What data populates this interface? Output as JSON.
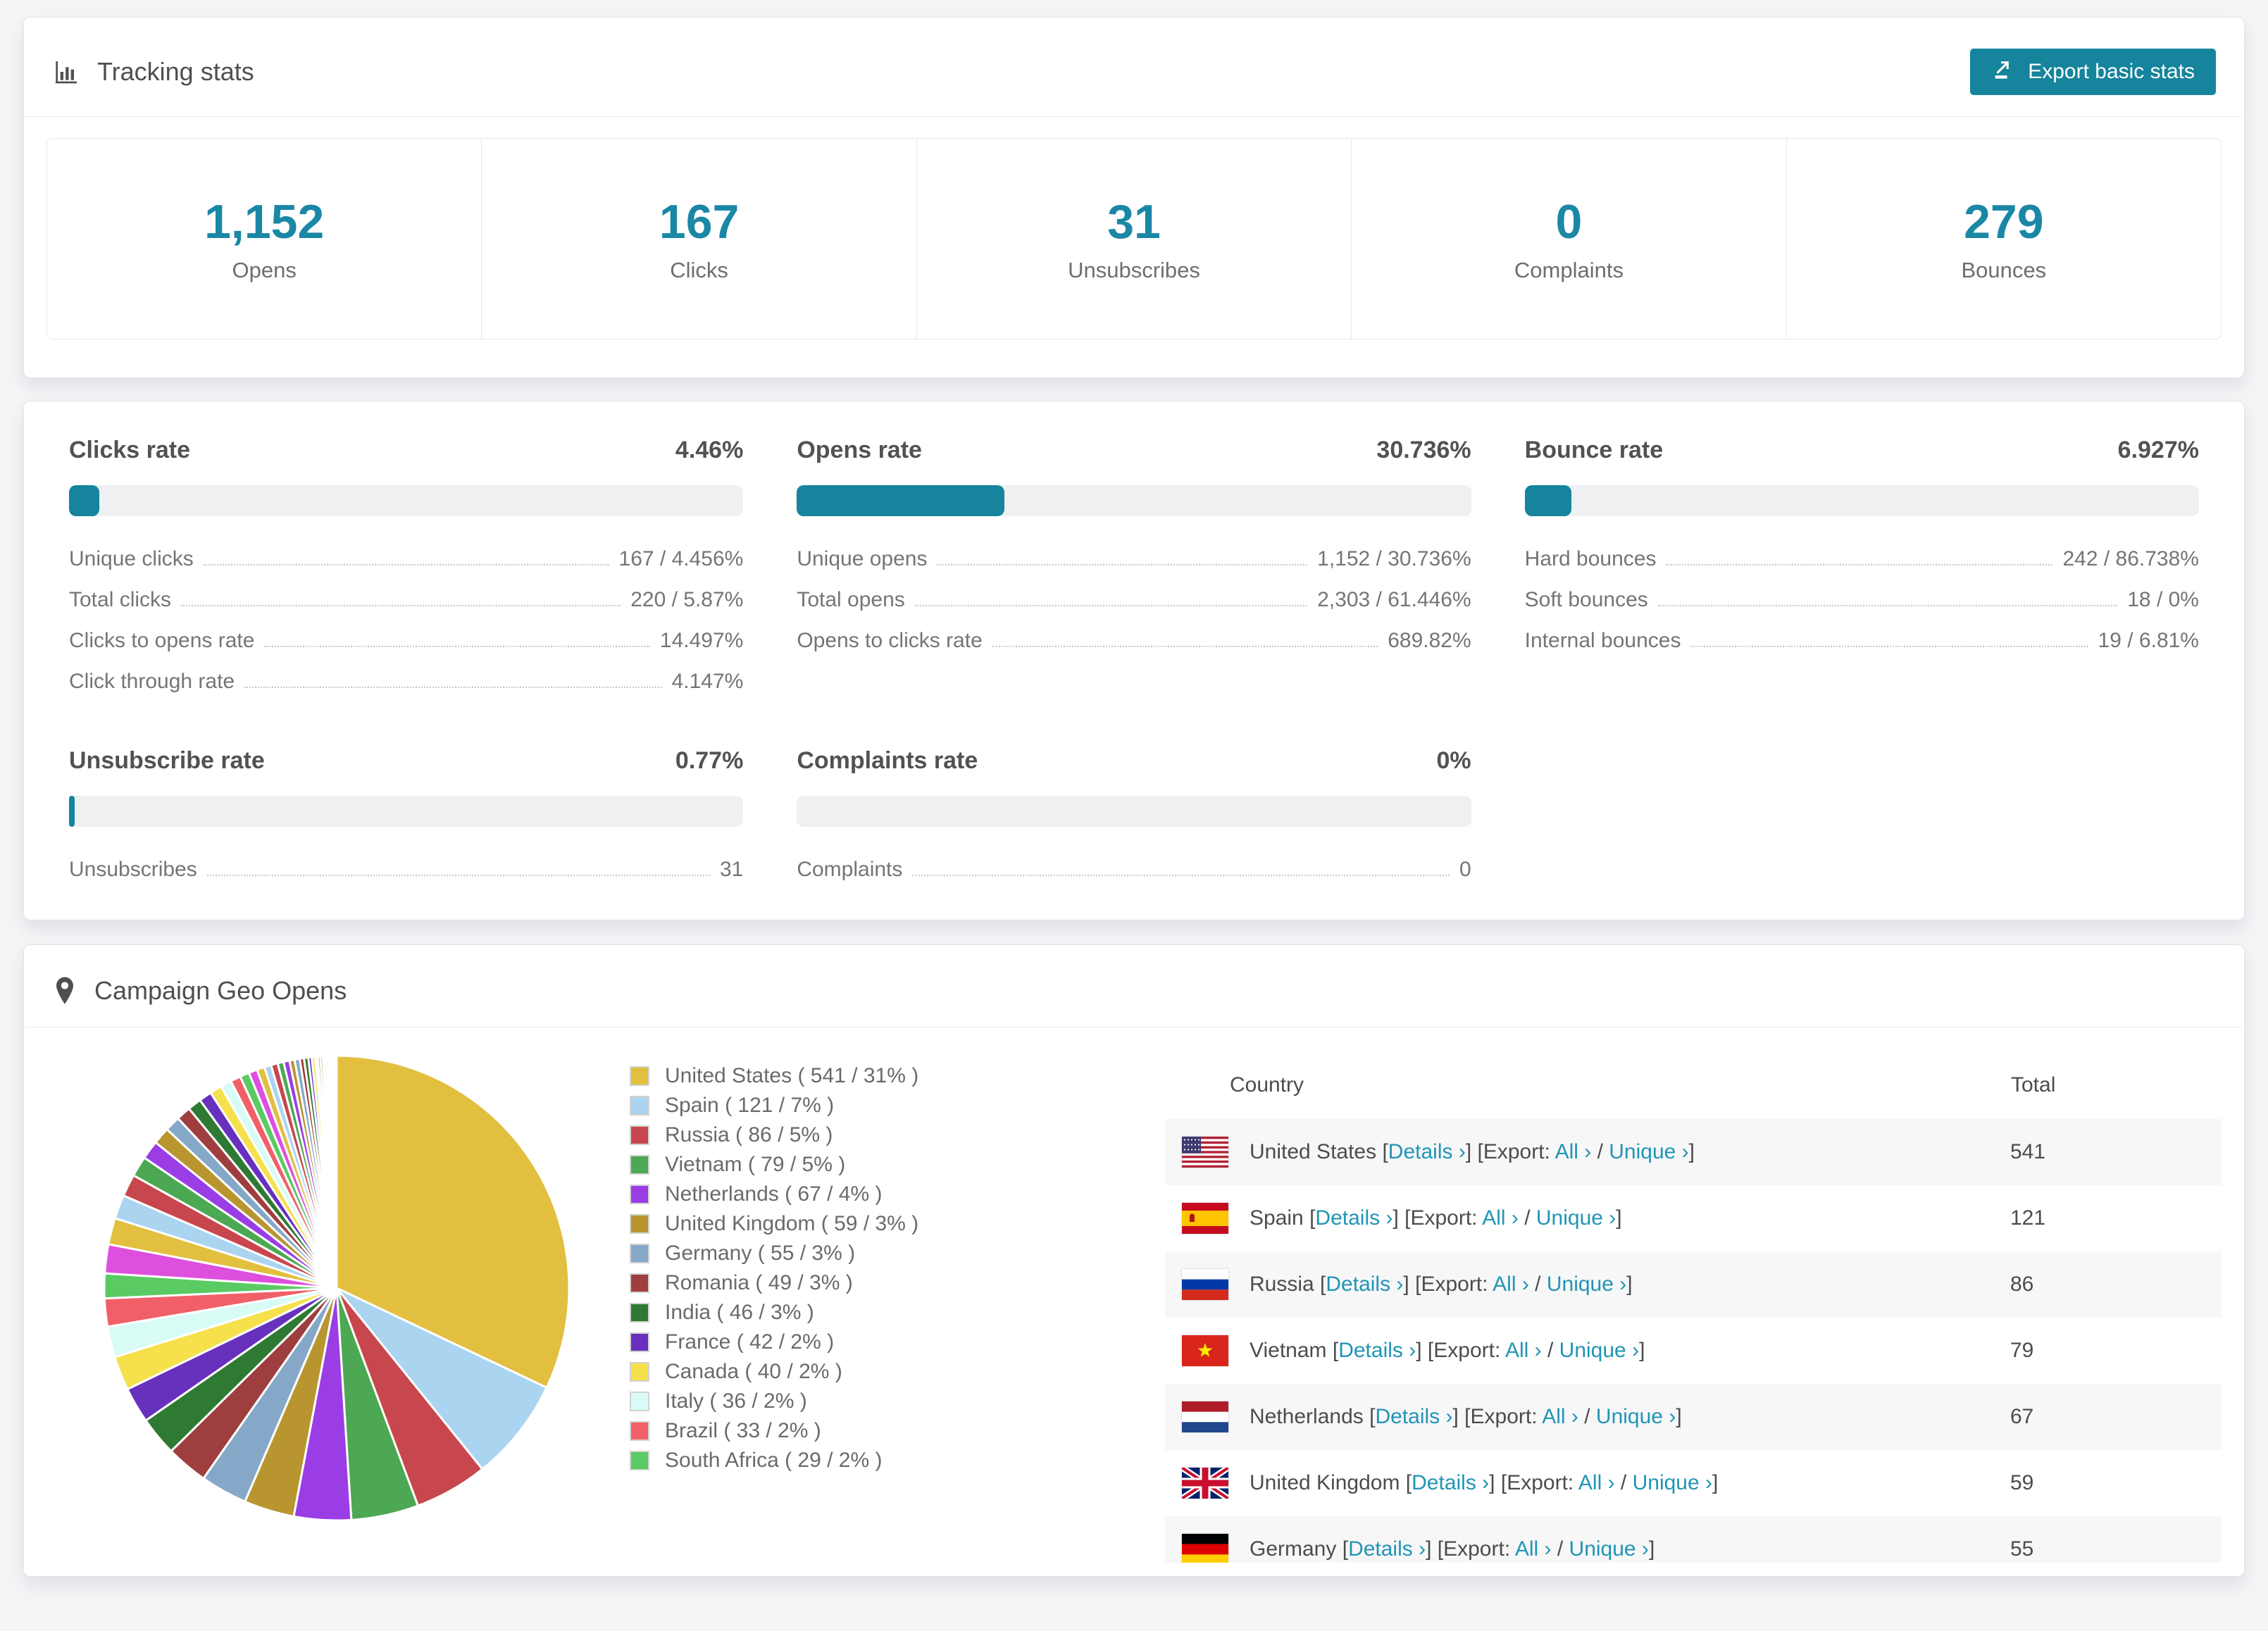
{
  "theme": {
    "accent": "#15849c",
    "stat_number_color": "#1a87a5",
    "link_color": "#2095b5",
    "bar_track_color": "#eef0f2"
  },
  "tracking": {
    "title": "Tracking stats",
    "export_button": "Export basic stats",
    "stats": [
      {
        "value": "1,152",
        "label": "Opens"
      },
      {
        "value": "167",
        "label": "Clicks"
      },
      {
        "value": "31",
        "label": "Unsubscribes"
      },
      {
        "value": "0",
        "label": "Complaints"
      },
      {
        "value": "279",
        "label": "Bounces"
      }
    ]
  },
  "rates": [
    {
      "title": "Clicks rate",
      "value": "4.46%",
      "percent": 4.46,
      "rows": [
        {
          "label": "Unique clicks",
          "value": "167 / 4.456%"
        },
        {
          "label": "Total clicks",
          "value": "220 / 5.87%"
        },
        {
          "label": "Clicks to opens rate",
          "value": "14.497%"
        },
        {
          "label": "Click through rate",
          "value": "4.147%"
        }
      ]
    },
    {
      "title": "Opens rate",
      "value": "30.736%",
      "percent": 30.736,
      "rows": [
        {
          "label": "Unique opens",
          "value": "1,152 / 30.736%"
        },
        {
          "label": "Total opens",
          "value": "2,303 / 61.446%"
        },
        {
          "label": "Opens to clicks rate",
          "value": "689.82%"
        }
      ]
    },
    {
      "title": "Bounce rate",
      "value": "6.927%",
      "percent": 6.927,
      "rows": [
        {
          "label": "Hard bounces",
          "value": "242 / 86.738%"
        },
        {
          "label": "Soft bounces",
          "value": "18 / 0%"
        },
        {
          "label": "Internal bounces",
          "value": "19 / 6.81%"
        }
      ]
    },
    {
      "title": "Unsubscribe rate",
      "value": "0.77%",
      "percent": 0.77,
      "rows": [
        {
          "label": "Unsubscribes",
          "value": "31"
        }
      ]
    },
    {
      "title": "Complaints rate",
      "value": "0%",
      "percent": 0,
      "rows": [
        {
          "label": "Complaints",
          "value": "0"
        }
      ]
    }
  ],
  "geo": {
    "title": "Campaign Geo Opens",
    "table": {
      "columns": [
        "Country",
        "Total"
      ],
      "links": {
        "bracket_open": "[",
        "bracket_close": "]",
        "details": "Details ›",
        "export_prefix": "Export:",
        "all": "All ›",
        "slash": " / ",
        "unique": "Unique ›"
      },
      "rows": [
        {
          "country": "United States",
          "flag": "us",
          "total": "541"
        },
        {
          "country": "Spain",
          "flag": "es",
          "total": "121"
        },
        {
          "country": "Russia",
          "flag": "ru",
          "total": "86"
        },
        {
          "country": "Vietnam",
          "flag": "vn",
          "total": "79"
        },
        {
          "country": "Netherlands",
          "flag": "nl",
          "total": "67"
        },
        {
          "country": "United Kingdom",
          "flag": "gb",
          "total": "59"
        },
        {
          "country": "Germany",
          "flag": "de",
          "total": "55",
          "partial": true
        }
      ]
    }
  },
  "chart_data": {
    "type": "pie",
    "title": "Campaign Geo Opens",
    "legend_position": "right",
    "start_angle_deg": -90,
    "direction": "clockwise",
    "countries": [
      {
        "label": "United States",
        "value": 541,
        "pct": "31%",
        "color": "#e2bf3f",
        "legend_label": "United States ( 541 / 31% )"
      },
      {
        "label": "Spain",
        "value": 121,
        "pct": "7%",
        "color": "#abd4f1",
        "legend_label": "Spain ( 121 / 7% )"
      },
      {
        "label": "Russia",
        "value": 86,
        "pct": "5%",
        "color": "#c8474e",
        "legend_label": "Russia ( 86 / 5% )"
      },
      {
        "label": "Vietnam",
        "value": 79,
        "pct": "5%",
        "color": "#4ca852",
        "legend_label": "Vietnam ( 79 / 5% )"
      },
      {
        "label": "Netherlands",
        "value": 67,
        "pct": "4%",
        "color": "#9b3de5",
        "legend_label": "Netherlands ( 67 / 4% )"
      },
      {
        "label": "United Kingdom",
        "value": 59,
        "pct": "3%",
        "color": "#b8952f",
        "legend_label": "United Kingdom ( 59 / 3% )"
      },
      {
        "label": "Germany",
        "value": 55,
        "pct": "3%",
        "color": "#86a8c8",
        "legend_label": "Germany ( 55 / 3% )"
      },
      {
        "label": "Romania",
        "value": 49,
        "pct": "3%",
        "color": "#9f3e3e",
        "legend_label": "Romania ( 49 / 3% )"
      },
      {
        "label": "India",
        "value": 46,
        "pct": "3%",
        "color": "#2e7a33",
        "legend_label": "India ( 46 / 3% )"
      },
      {
        "label": "France",
        "value": 42,
        "pct": "2%",
        "color": "#6730bd",
        "legend_label": "France ( 42 / 2% )"
      },
      {
        "label": "Canada",
        "value": 40,
        "pct": "2%",
        "color": "#f6e04b",
        "legend_label": "Canada ( 40 / 2% )"
      },
      {
        "label": "Italy",
        "value": 36,
        "pct": "2%",
        "color": "#d8fcf5",
        "legend_label": "Italy ( 36 / 2% )"
      },
      {
        "label": "Brazil",
        "value": 33,
        "pct": "2%",
        "color": "#f15f68",
        "legend_label": "Brazil ( 33 / 2% )"
      },
      {
        "label": "South Africa",
        "value": 29,
        "pct": "2%",
        "color": "#5aca63",
        "legend_label": "South Africa ( 29 / 2% )"
      }
    ],
    "unlabeled_tail_values_estimated": [
      34,
      31,
      28,
      26,
      24,
      22,
      20,
      18,
      17,
      16,
      15,
      14,
      13,
      12,
      11,
      10,
      9,
      8,
      8,
      7,
      7,
      6,
      6,
      5,
      5,
      4,
      4,
      3,
      3,
      3,
      2,
      2,
      2,
      2,
      1,
      1,
      1,
      1,
      1,
      1,
      1,
      1
    ],
    "tail_palette": [
      "#dd4fdd",
      "#e2bf3f",
      "#abd4f1",
      "#c8474e",
      "#4ca852",
      "#9b3de5",
      "#b8952f",
      "#86a8c8",
      "#9f3e3e",
      "#2e7a33",
      "#6730bd",
      "#f6e04b",
      "#d8fcf5",
      "#f15f68",
      "#5aca63"
    ]
  }
}
